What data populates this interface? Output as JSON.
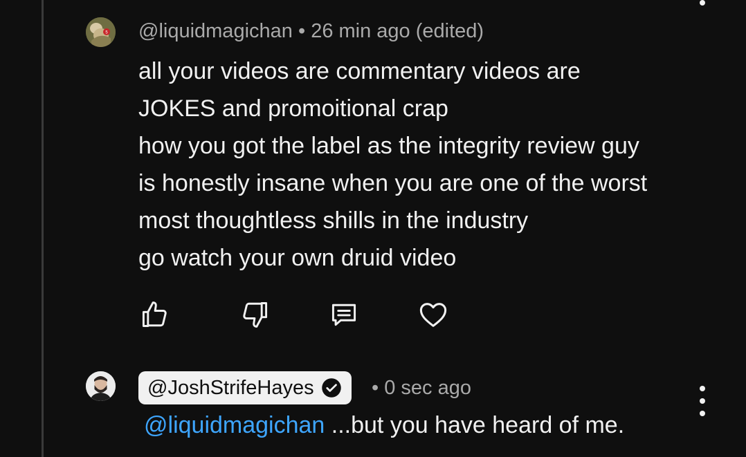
{
  "comment": {
    "author": "@liquidmagichan",
    "meta_separator": "•",
    "time": "26 min ago (edited)",
    "lines": [
      "all your videos are commentary videos are",
      "JOKES and promoitional crap",
      "how you got the label as the integrity review guy",
      "is honestly insane when you are one of the worst",
      "most thoughtless shills in the industry",
      "go watch your own druid video"
    ],
    "actions": {
      "like_icon": "thumbs-up-icon",
      "dislike_icon": "thumbs-down-icon",
      "reply_icon": "reply-comment-icon",
      "heart_icon": "heart-icon"
    }
  },
  "reply": {
    "author": "@JoshStrifeHayes",
    "verified_icon": "verified-check-icon",
    "meta_separator": "•",
    "time": "0 sec ago",
    "mention": "@liquidmagichan",
    "text": " ...but you have heard of me.",
    "menu_icon": "more-vertical-icon"
  },
  "colors": {
    "background": "#0f0f0f",
    "text": "#f1f1f1",
    "meta": "#aaaaaa",
    "mention": "#3ea6ff",
    "chip": "#f1f1f1"
  }
}
